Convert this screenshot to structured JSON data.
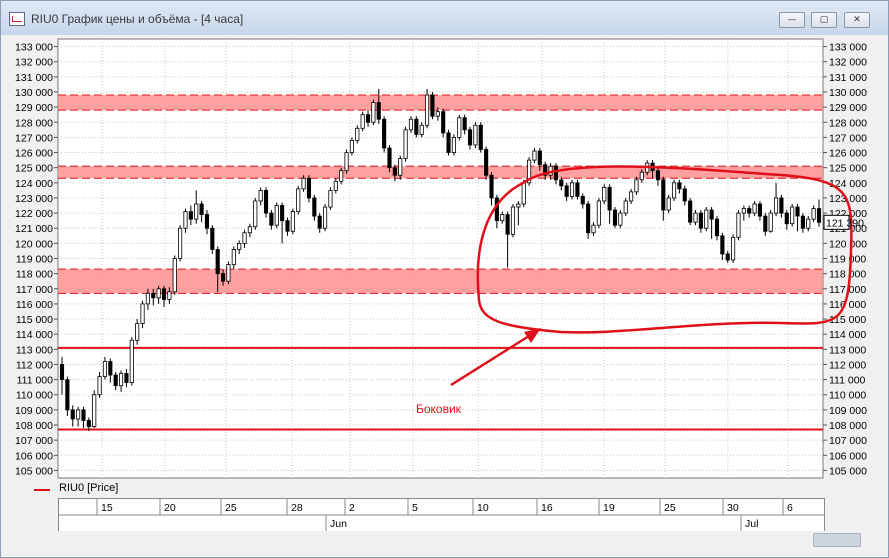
{
  "window": {
    "title": "RIU0 График цены и объёма - [4 часа]",
    "min_glyph": "—",
    "max_glyph": "▢",
    "close_glyph": "✕"
  },
  "legend": {
    "label": "RIU0 [Price]",
    "color": "#e0101a"
  },
  "colors": {
    "zone_fill": "#ff8a8a",
    "line_red": "#e0101a",
    "grid": "#c8c8c8",
    "candle": "#000000",
    "annotation": "#e0101a"
  },
  "annotation": {
    "label": "Боковик"
  },
  "price_marker": {
    "value": 121390,
    "label": "121 390"
  },
  "chart_data": {
    "type": "candlestick",
    "ylim": [
      104500,
      133500
    ],
    "y_ticks": [
      105000,
      106000,
      107000,
      108000,
      109000,
      110000,
      111000,
      112000,
      113000,
      114000,
      115000,
      116000,
      117000,
      118000,
      119000,
      120000,
      121000,
      122000,
      123000,
      124000,
      125000,
      126000,
      127000,
      128000,
      129000,
      130000,
      131000,
      132000,
      133000
    ],
    "y_tick_labels": [
      "105 000",
      "106 000",
      "107 000",
      "108 000",
      "109 000",
      "110 000",
      "111 000",
      "112 000",
      "113 000",
      "114 000",
      "115 000",
      "116 000",
      "117 000",
      "118 000",
      "119 000",
      "120 000",
      "121 000",
      "122 000",
      "123 000",
      "124 000",
      "125 000",
      "126 000",
      "127 000",
      "128 000",
      "129 000",
      "130 000",
      "131 000",
      "132 000",
      "133 000"
    ],
    "x_day_labels": [
      "15",
      "20",
      "25",
      "28",
      "2",
      "5",
      "10",
      "16",
      "19",
      "25",
      "30",
      "6"
    ],
    "x_month_labels": [
      "Jun",
      "Jul"
    ],
    "resistance_zones": [
      {
        "low": 128800,
        "high": 129800
      },
      {
        "low": 124300,
        "high": 125100
      },
      {
        "low": 116700,
        "high": 118300
      }
    ],
    "horizontal_lines": [
      113100,
      107700
    ],
    "candles": [
      [
        112000,
        111000,
        112500,
        110000
      ],
      [
        111000,
        109000,
        111200,
        108600
      ],
      [
        109000,
        108400,
        109300,
        107900
      ],
      [
        108400,
        109000,
        109200,
        107900
      ],
      [
        109000,
        108300,
        109200,
        107800
      ],
      [
        108300,
        107900,
        108500,
        107600
      ],
      [
        107900,
        110000,
        110300,
        107800
      ],
      [
        110000,
        111200,
        111500,
        109800
      ],
      [
        111200,
        112200,
        112500,
        111000
      ],
      [
        112200,
        111300,
        112400,
        110800
      ],
      [
        111300,
        110600,
        111500,
        110300
      ],
      [
        110600,
        111400,
        111600,
        110200
      ],
      [
        111400,
        110800,
        111700,
        110500
      ],
      [
        110800,
        113600,
        113800,
        110600
      ],
      [
        113600,
        114700,
        115000,
        113300
      ],
      [
        114700,
        116000,
        116200,
        114400
      ],
      [
        116000,
        116700,
        117000,
        115600
      ],
      [
        116700,
        116400,
        117000,
        115900
      ],
      [
        116400,
        117000,
        117200,
        116000
      ],
      [
        117000,
        116300,
        117200,
        115800
      ],
      [
        116300,
        116800,
        117100,
        116000
      ],
      [
        116800,
        119000,
        119200,
        116600
      ],
      [
        119000,
        121000,
        121200,
        118800
      ],
      [
        121000,
        122100,
        122300,
        120700
      ],
      [
        122100,
        121600,
        122500,
        121200
      ],
      [
        121600,
        122600,
        123500,
        121300
      ],
      [
        122600,
        121900,
        122800,
        121400
      ],
      [
        121900,
        121000,
        122200,
        120600
      ],
      [
        121000,
        119600,
        121200,
        119300
      ],
      [
        119600,
        118000,
        119800,
        116800
      ],
      [
        118000,
        117500,
        118300,
        117200
      ],
      [
        117500,
        118600,
        118800,
        117300
      ],
      [
        118600,
        119600,
        119800,
        118300
      ],
      [
        119600,
        120000,
        120200,
        119300
      ],
      [
        120000,
        120700,
        120900,
        119700
      ],
      [
        120700,
        121100,
        121300,
        120400
      ],
      [
        121100,
        122800,
        123000,
        120900
      ],
      [
        122800,
        123500,
        123700,
        122500
      ],
      [
        123500,
        122000,
        123700,
        121700
      ],
      [
        122000,
        121200,
        122200,
        120900
      ],
      [
        121200,
        122500,
        122700,
        121000
      ],
      [
        122500,
        121500,
        122700,
        120000
      ],
      [
        121500,
        120800,
        121700,
        120500
      ],
      [
        120800,
        122100,
        122300,
        120600
      ],
      [
        122100,
        123600,
        123800,
        121900
      ],
      [
        123600,
        124300,
        124500,
        123400
      ],
      [
        124300,
        123000,
        124500,
        122700
      ],
      [
        123000,
        121800,
        123200,
        121500
      ],
      [
        121800,
        121000,
        122000,
        120700
      ],
      [
        121000,
        122400,
        122600,
        120800
      ],
      [
        122400,
        123500,
        123700,
        122200
      ],
      [
        123500,
        124100,
        124300,
        123300
      ],
      [
        124100,
        124800,
        125000,
        123900
      ],
      [
        124800,
        126000,
        126200,
        124600
      ],
      [
        126000,
        126800,
        127000,
        125800
      ],
      [
        126800,
        127600,
        127800,
        126600
      ],
      [
        127600,
        128500,
        128700,
        127400
      ],
      [
        128500,
        128000,
        128800,
        127700
      ],
      [
        128000,
        129300,
        129500,
        127800
      ],
      [
        129300,
        128200,
        130200,
        127900
      ],
      [
        128200,
        126300,
        128400,
        126000
      ],
      [
        126300,
        125000,
        126500,
        124700
      ],
      [
        125000,
        124500,
        125200,
        124100
      ],
      [
        124500,
        125600,
        125800,
        124200
      ],
      [
        125600,
        127500,
        127700,
        125400
      ],
      [
        127500,
        128200,
        128400,
        127300
      ],
      [
        128200,
        127200,
        128400,
        127000
      ],
      [
        127200,
        127800,
        128000,
        127000
      ],
      [
        127800,
        129800,
        130200,
        127600
      ],
      [
        129800,
        128400,
        130000,
        128200
      ],
      [
        128400,
        128700,
        129000,
        128100
      ],
      [
        128700,
        127300,
        128900,
        127000
      ],
      [
        127300,
        126000,
        127500,
        125800
      ],
      [
        126000,
        127000,
        127200,
        125800
      ],
      [
        127000,
        128300,
        128500,
        126800
      ],
      [
        128300,
        127500,
        128500,
        127200
      ],
      [
        127500,
        126500,
        127700,
        126200
      ],
      [
        126500,
        127800,
        128000,
        126300
      ],
      [
        127800,
        126200,
        128000,
        126000
      ],
      [
        126200,
        124500,
        126400,
        124200
      ],
      [
        124500,
        123000,
        124700,
        122500
      ],
      [
        123000,
        121500,
        123200,
        121000
      ],
      [
        121500,
        121900,
        122100,
        121300
      ],
      [
        121900,
        120600,
        122100,
        118400
      ],
      [
        120600,
        122400,
        122600,
        120400
      ],
      [
        122400,
        122600,
        122800,
        121200
      ],
      [
        122600,
        124000,
        124200,
        122400
      ],
      [
        124000,
        125500,
        125700,
        123800
      ],
      [
        125500,
        126100,
        126300,
        125300
      ],
      [
        126100,
        125200,
        126300,
        124800
      ],
      [
        125200,
        124500,
        125400,
        124200
      ],
      [
        124500,
        125100,
        125300,
        124200
      ],
      [
        125100,
        124200,
        125300,
        123900
      ],
      [
        124200,
        123800,
        124400,
        123500
      ],
      [
        123800,
        123100,
        124000,
        122800
      ],
      [
        123100,
        124000,
        124200,
        122900
      ],
      [
        124000,
        123100,
        124200,
        122900
      ],
      [
        123100,
        122600,
        123300,
        122300
      ],
      [
        122600,
        120700,
        122800,
        120300
      ],
      [
        120700,
        121200,
        121400,
        120500
      ],
      [
        121200,
        122800,
        123000,
        121000
      ],
      [
        122800,
        123700,
        123900,
        122600
      ],
      [
        123700,
        122200,
        123900,
        121300
      ],
      [
        122200,
        121200,
        122400,
        121000
      ],
      [
        121200,
        122000,
        122200,
        121000
      ],
      [
        122000,
        122800,
        123000,
        121800
      ],
      [
        122800,
        123400,
        123600,
        122600
      ],
      [
        123400,
        124200,
        124400,
        123200
      ],
      [
        124200,
        124700,
        124900,
        124000
      ],
      [
        124700,
        125300,
        125500,
        124500
      ],
      [
        125300,
        124800,
        125500,
        124300
      ],
      [
        124800,
        124200,
        125000,
        123800
      ],
      [
        124200,
        122200,
        124400,
        121500
      ],
      [
        122200,
        123000,
        123200,
        122000
      ],
      [
        123000,
        124000,
        124200,
        122800
      ],
      [
        124000,
        123600,
        124200,
        123300
      ],
      [
        123600,
        122800,
        123800,
        122500
      ],
      [
        122800,
        121400,
        123000,
        121200
      ],
      [
        121400,
        122000,
        122200,
        121200
      ],
      [
        122000,
        121000,
        122200,
        120700
      ],
      [
        121000,
        122200,
        122400,
        120800
      ],
      [
        122200,
        121600,
        122400,
        120300
      ],
      [
        121600,
        120500,
        121800,
        120200
      ],
      [
        120500,
        119300,
        120700,
        118900
      ],
      [
        119300,
        118900,
        119500,
        118700
      ],
      [
        118900,
        120400,
        120600,
        118700
      ],
      [
        120400,
        122000,
        122200,
        120200
      ],
      [
        122000,
        122300,
        122500,
        121500
      ],
      [
        122300,
        122000,
        122500,
        121700
      ],
      [
        122000,
        122600,
        122800,
        121800
      ],
      [
        122600,
        121800,
        122800,
        121500
      ],
      [
        121800,
        120800,
        122000,
        120500
      ],
      [
        120800,
        122000,
        122200,
        120700
      ],
      [
        122000,
        123000,
        124000,
        121800
      ],
      [
        123000,
        122000,
        123200,
        121700
      ],
      [
        122000,
        121300,
        122200,
        120900
      ],
      [
        121300,
        122400,
        122600,
        121100
      ],
      [
        122400,
        121800,
        122600,
        120800
      ],
      [
        121800,
        121000,
        122000,
        120700
      ],
      [
        121000,
        121600,
        121800,
        120800
      ],
      [
        121600,
        122300,
        122500,
        121400
      ],
      [
        122300,
        121390,
        122900,
        121100
      ]
    ]
  }
}
